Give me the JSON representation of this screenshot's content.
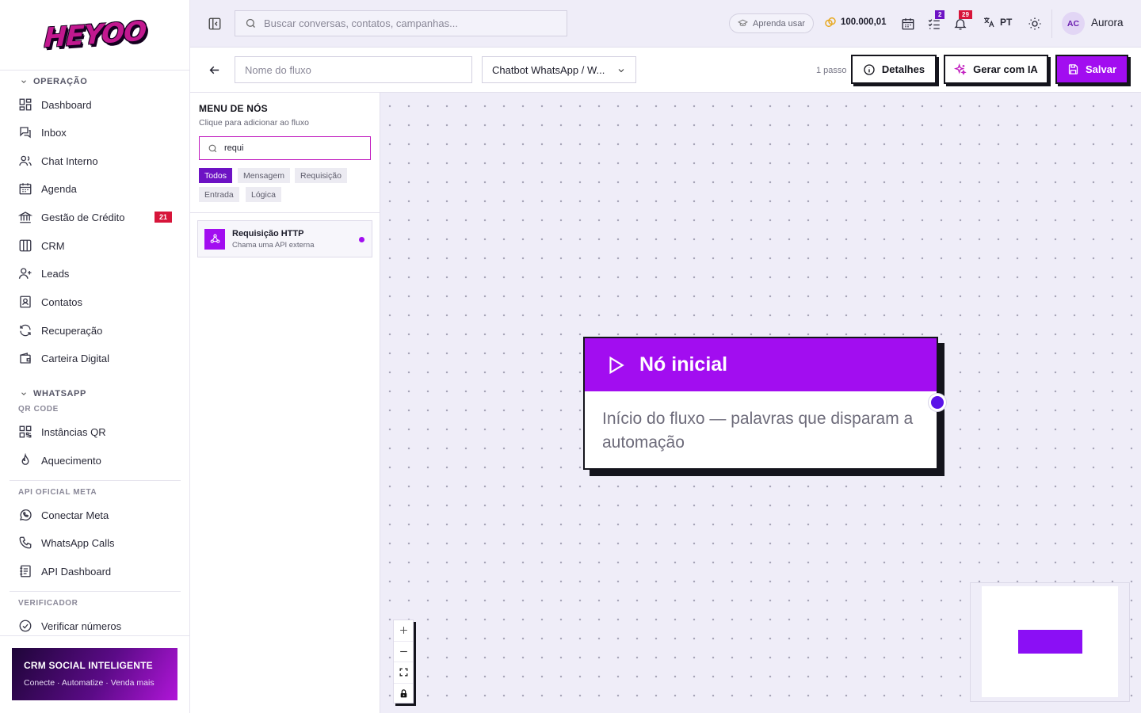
{
  "brand": {
    "logo_text": "HEYOO"
  },
  "sidebar": {
    "sections": [
      {
        "label": "OPERAÇÃO"
      },
      {
        "label": "WHATSAPP",
        "sub": "QR CODE"
      },
      {
        "label": "API OFICIAL META"
      },
      {
        "label": "VERIFICADOR"
      }
    ],
    "items": [
      {
        "label": "Dashboard",
        "icon": "dashboard-icon"
      },
      {
        "label": "Inbox",
        "icon": "inbox-icon"
      },
      {
        "label": "Chat Interno",
        "icon": "users-icon"
      },
      {
        "label": "Agenda",
        "icon": "calendar-icon"
      },
      {
        "label": "Gestão de Crédito",
        "icon": "bank-icon",
        "badge": "21"
      },
      {
        "label": "CRM",
        "icon": "columns-icon"
      },
      {
        "label": "Leads",
        "icon": "user-plus-icon"
      },
      {
        "label": "Contatos",
        "icon": "contact-icon"
      },
      {
        "label": "Recuperação",
        "icon": "refresh-icon"
      },
      {
        "label": "Carteira Digital",
        "icon": "wallet-icon"
      },
      {
        "label": "Instâncias QR",
        "icon": "qr-icon"
      },
      {
        "label": "Aquecimento",
        "icon": "flame-icon"
      },
      {
        "label": "Conectar Meta",
        "icon": "whatsapp-icon"
      },
      {
        "label": "WhatsApp Calls",
        "icon": "phone-icon"
      },
      {
        "label": "API Dashboard",
        "icon": "api-icon"
      },
      {
        "label": "Verificar números",
        "icon": "check-circle-icon"
      }
    ],
    "promo": {
      "title": "CRM SOCIAL INTELIGENTE",
      "subtitle": "Conecte · Automatize · Venda mais"
    }
  },
  "topbar": {
    "search_placeholder": "Buscar conversas, contatos, campanhas...",
    "learn_label": "Aprenda usar",
    "credits": "100.000,01",
    "tasks_badge": "2",
    "notifications_badge": "29",
    "language": "PT",
    "user_initials": "AC",
    "user_name": "Aurora"
  },
  "flow": {
    "name_placeholder": "Nome do fluxo",
    "type_value": "Chatbot WhatsApp / W...",
    "steps_label": "1 passo",
    "details_label": "Detalhes",
    "ai_label": "Gerar com IA",
    "save_label": "Salvar"
  },
  "node_menu": {
    "title": "MENU DE NÓS",
    "subtitle": "Clique para adicionar ao fluxo",
    "search_value": "requi",
    "filters": [
      "Todos",
      "Mensagem",
      "Requisição",
      "Entrada",
      "Lógica"
    ],
    "active_filter": "Todos",
    "results": [
      {
        "title": "Requisição HTTP",
        "description": "Chama uma API externa",
        "icon": "webhook-icon"
      }
    ]
  },
  "canvas": {
    "start_node": {
      "title": "Nó inicial",
      "description": "Início do fluxo — palavras que disparam a automação"
    }
  },
  "colors": {
    "accent": "#a20df0",
    "accent_dark": "#6d12c4",
    "danger": "#d7153a",
    "canvas_bg": "#efedf8"
  }
}
